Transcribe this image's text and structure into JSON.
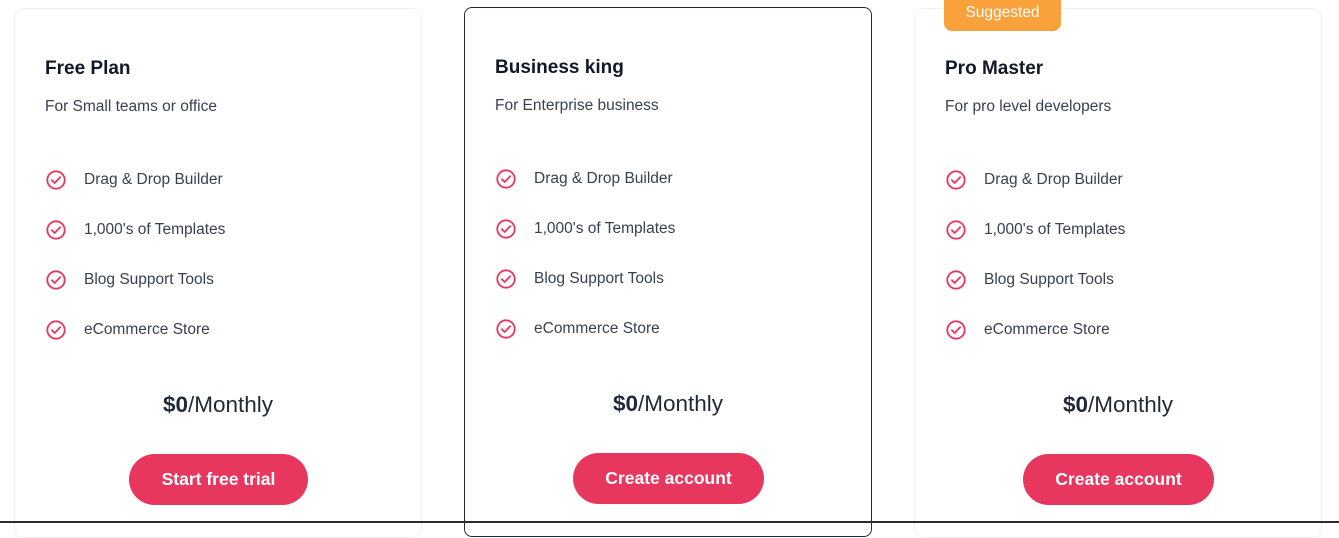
{
  "plans": [
    {
      "name": "Free Plan",
      "description": "For Small teams or office",
      "features": [
        "Drag & Drop Builder",
        "1,000's of Templates",
        "Blog Support Tools",
        "eCommerce Store"
      ],
      "price_amount": "$0",
      "price_period": "/Monthly",
      "cta_label": "Start free trial"
    },
    {
      "name": "Business king",
      "description": "For Enterprise business",
      "features": [
        "Drag & Drop Builder",
        "1,000's of Templates",
        "Blog Support Tools",
        "eCommerce Store"
      ],
      "price_amount": "$0",
      "price_period": "/Monthly",
      "cta_label": "Create account"
    },
    {
      "name": "Pro Master",
      "description": "For pro level developers",
      "features": [
        "Drag & Drop Builder",
        "1,000's of Templates",
        "Blog Support Tools",
        "eCommerce Store"
      ],
      "price_amount": "$0",
      "price_period": "/Monthly",
      "cta_label": "Create account"
    }
  ],
  "badge": {
    "label": "Suggested"
  },
  "icons": {
    "feature": "check-circle-icon"
  },
  "colors": {
    "accent": "#e8375f",
    "badge": "#f9a23b",
    "featured_border": "#1e2a44",
    "heading": "#111827",
    "text": "#374151"
  }
}
